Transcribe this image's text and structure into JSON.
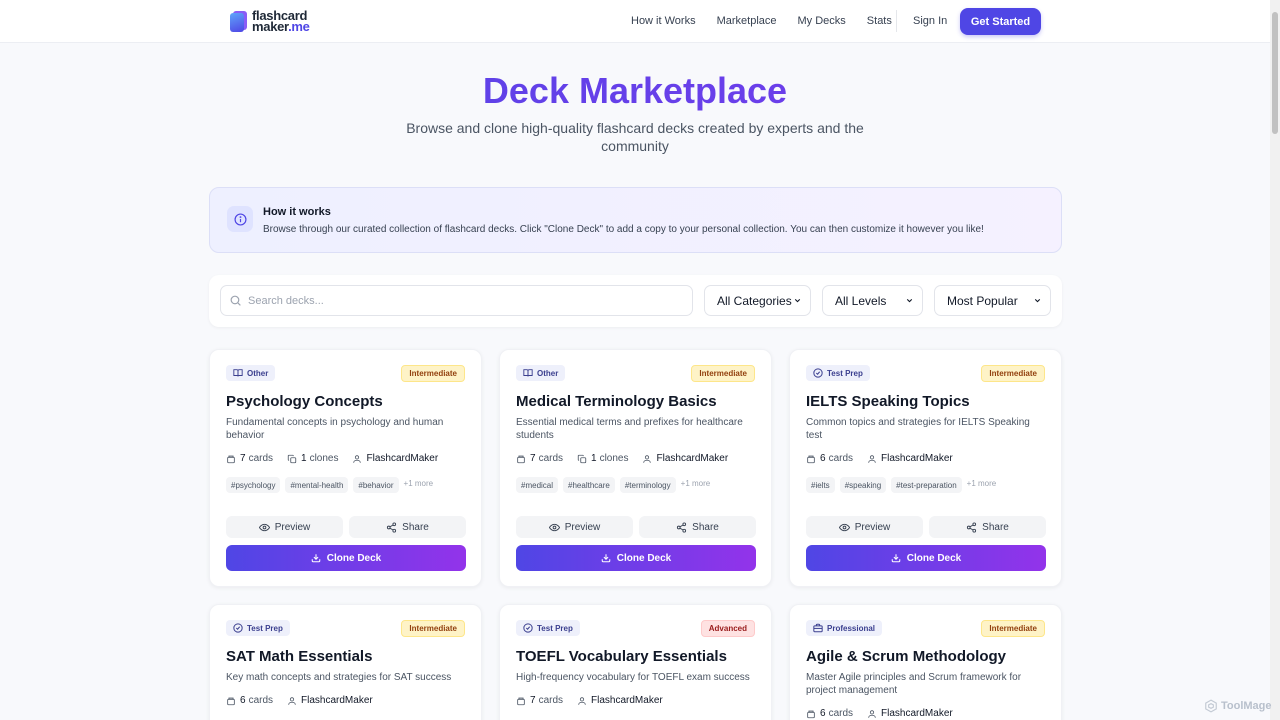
{
  "nav": {
    "logo_line1": "flashcard",
    "logo_line2": "maker",
    "logo_tld": ".me",
    "links": [
      "How it Works",
      "Marketplace",
      "My Decks",
      "Stats"
    ],
    "sign_in": "Sign In",
    "get_started": "Get Started"
  },
  "hero": {
    "title": "Deck Marketplace",
    "subtitle": "Browse and clone high-quality flashcard decks created by experts and the community"
  },
  "info": {
    "icon": "info-icon",
    "title": "How it works",
    "text": "Browse through our curated collection of flashcard decks. Click \"Clone Deck\" to add a copy to your personal collection. You can then customize it however you like!"
  },
  "filters": {
    "search_placeholder": "Search decks...",
    "category": "All Categories",
    "level": "All Levels",
    "sort": "Most Popular"
  },
  "labels": {
    "cards": "cards",
    "clones": "clones",
    "preview": "Preview",
    "share": "Share",
    "clone": "Clone Deck"
  },
  "decks": [
    {
      "category": "Other",
      "category_icon": "book-icon",
      "level": "Intermediate",
      "title": "Psychology Concepts",
      "description": "Fundamental concepts in psychology and human behavior",
      "cards": "7",
      "clones": "1",
      "author": "FlashcardMaker",
      "tags": [
        "#psychology",
        "#mental-health",
        "#behavior"
      ],
      "more": "+1 more"
    },
    {
      "category": "Other",
      "category_icon": "book-icon",
      "level": "Intermediate",
      "title": "Medical Terminology Basics",
      "description": "Essential medical terms and prefixes for healthcare students",
      "cards": "7",
      "clones": "1",
      "author": "FlashcardMaker",
      "tags": [
        "#medical",
        "#healthcare",
        "#terminology"
      ],
      "more": "+1 more"
    },
    {
      "category": "Test Prep",
      "category_icon": "check-circle-icon",
      "level": "Intermediate",
      "title": "IELTS Speaking Topics",
      "description": "Common topics and strategies for IELTS Speaking test",
      "cards": "6",
      "author": "FlashcardMaker",
      "tags": [
        "#ielts",
        "#speaking",
        "#test-preparation"
      ],
      "more": "+1 more"
    },
    {
      "category": "Test Prep",
      "category_icon": "check-circle-icon",
      "level": "Intermediate",
      "title": "SAT Math Essentials",
      "description": "Key math concepts and strategies for SAT success",
      "cards": "6",
      "author": "FlashcardMaker"
    },
    {
      "category": "Test Prep",
      "category_icon": "check-circle-icon",
      "level": "Advanced",
      "title": "TOEFL Vocabulary Essentials",
      "description": "High-frequency vocabulary for TOEFL exam success",
      "cards": "7",
      "author": "FlashcardMaker"
    },
    {
      "category": "Professional",
      "category_icon": "briefcase-icon",
      "level": "Intermediate",
      "title": "Agile & Scrum Methodology",
      "description": "Master Agile principles and Scrum framework for project management",
      "cards": "6",
      "author": "FlashcardMaker"
    }
  ],
  "watermark": "ToolMage"
}
